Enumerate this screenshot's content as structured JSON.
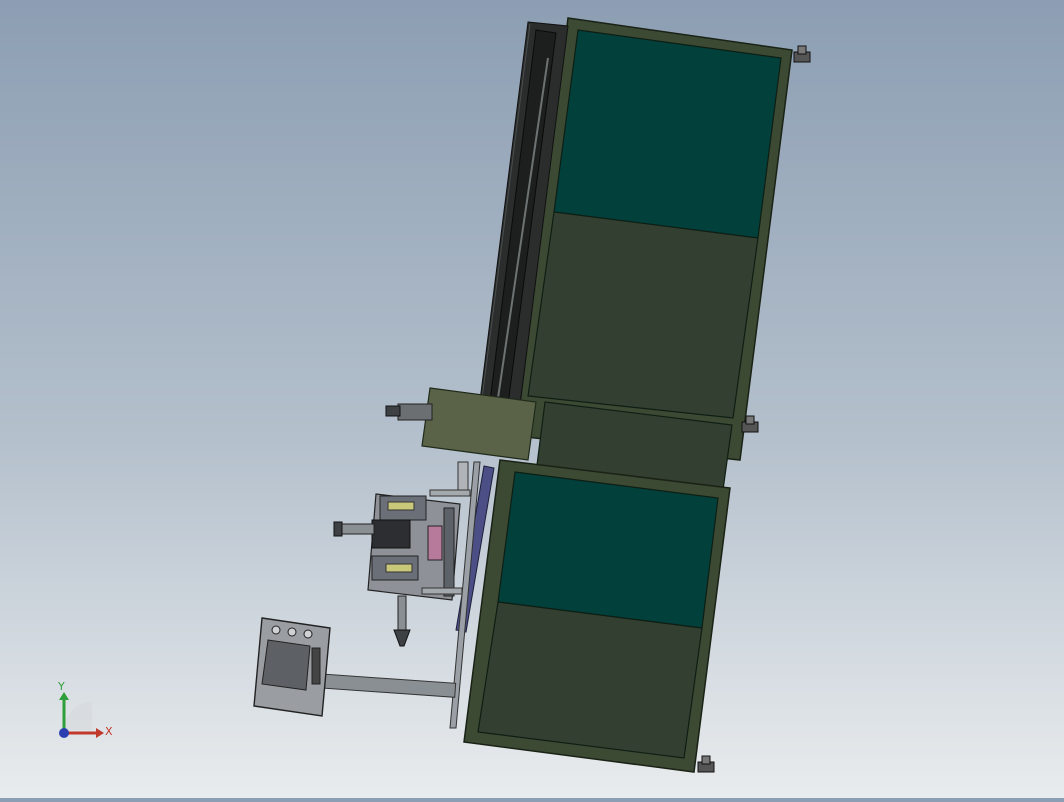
{
  "triad": {
    "x_label": "X",
    "y_label": "Y",
    "x_color": "#c0392b",
    "y_color": "#2e9e3a",
    "z_color": "#2b3fb0"
  },
  "colors": {
    "frame": "#3c4a34",
    "frame_dark": "#1f2a1a",
    "panel_teal": "#02403b",
    "panel_olive": "#333f30",
    "box_olive": "#5a6247",
    "rail_dark": "#1d1f1f",
    "steel": "#8a8f94",
    "hmi_body": "#9a9ea3",
    "hmi_screen": "#5d6165"
  },
  "model": {
    "hmi_icon": "control-panel-icon",
    "feet_icon": "leveling-foot-icon"
  }
}
